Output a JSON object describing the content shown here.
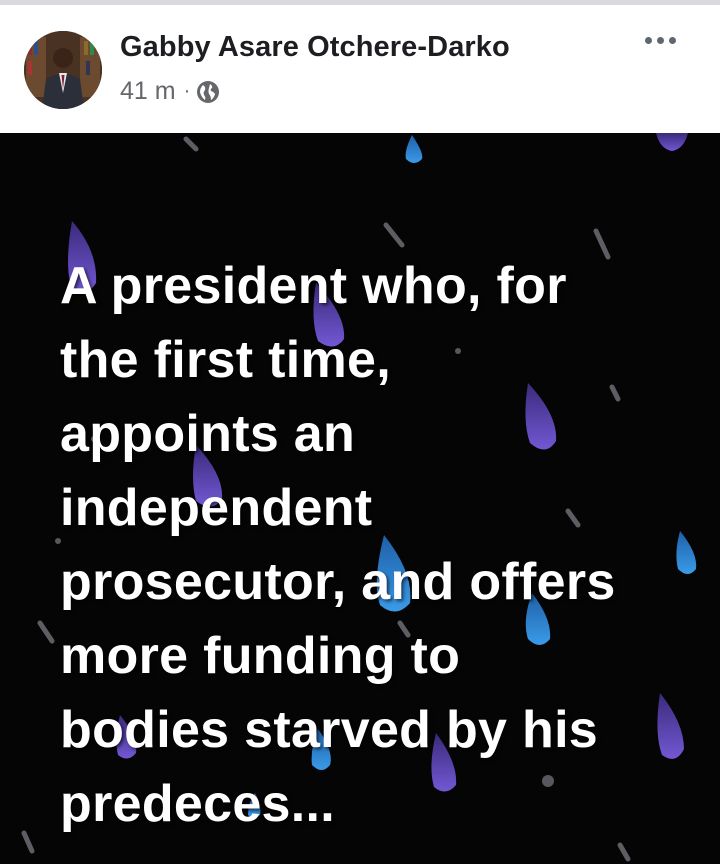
{
  "post": {
    "author": "Gabby Asare Otchere-Darko",
    "time": "41 m",
    "separator": "·",
    "privacy_icon": "globe-icon",
    "lines": [
      "A president who, for",
      "the first time,",
      "appoints an",
      "independent",
      "prosecutor, and offers",
      "more funding to",
      "bodies starved by his",
      "predeces..."
    ]
  },
  "colors": {
    "background_post": "#050505",
    "drop_blue": "#2e86de",
    "drop_purple": "#6a4fc9",
    "text": "#ffffff"
  }
}
